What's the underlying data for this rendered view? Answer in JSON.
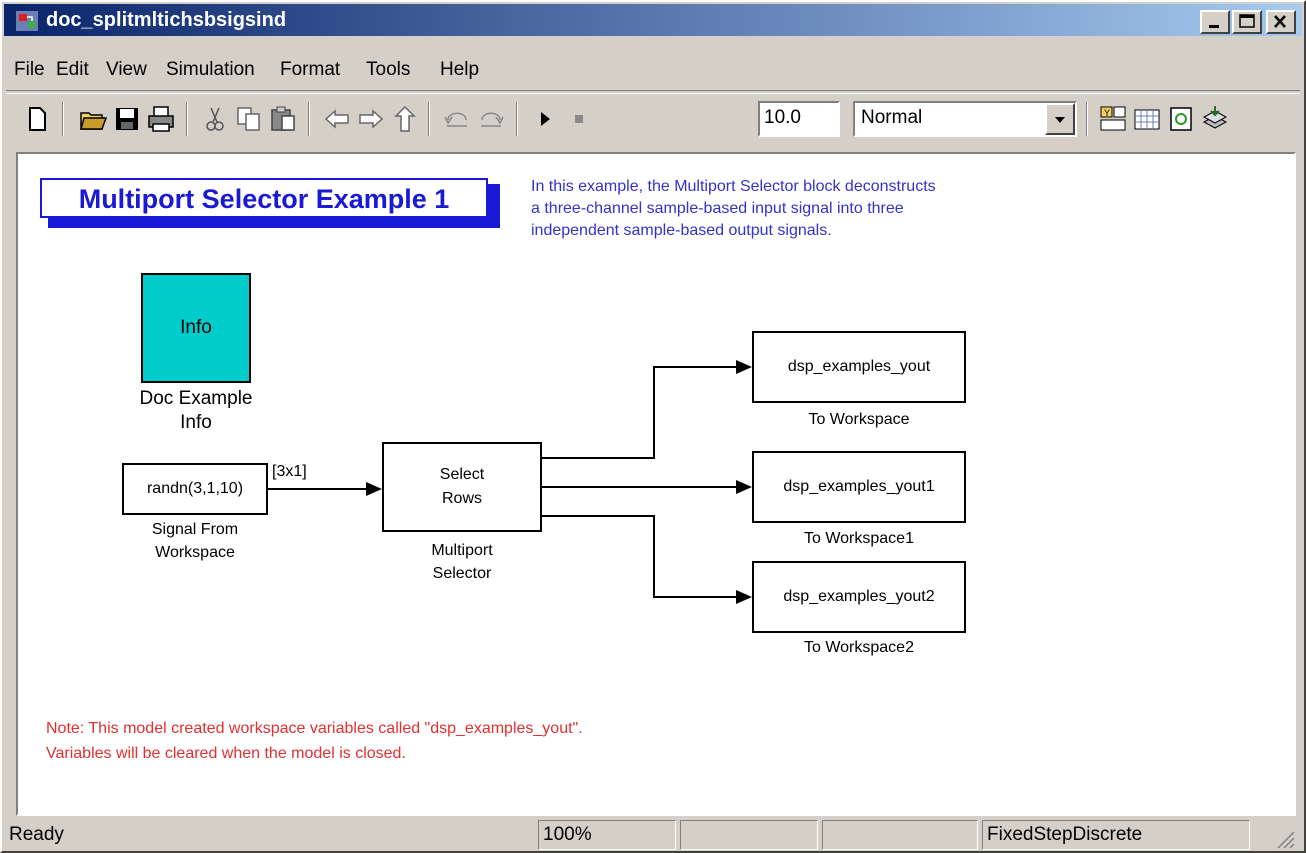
{
  "window": {
    "title": "doc_splitmltichsbsigsind"
  },
  "menu": [
    "File",
    "Edit",
    "View",
    "Simulation",
    "Format",
    "Tools",
    "Help"
  ],
  "toolbar": {
    "stop_time": "10.0",
    "sim_mode": "Normal",
    "icons": [
      "new-model-icon",
      "open-icon",
      "save-icon",
      "print-icon",
      "cut-icon",
      "copy-icon",
      "paste-icon",
      "back-icon",
      "forward-icon",
      "up-icon",
      "undo-icon",
      "redo-icon",
      "start-simulation-icon",
      "stop-simulation-icon",
      "library-browser-icon",
      "model-explorer-icon",
      "update-diagram-icon",
      "build-icon"
    ]
  },
  "diagram": {
    "title": "Multiport Selector Example 1",
    "description": [
      "In this example, the Multiport Selector block deconstructs",
      "a three-channel sample-based input signal into three",
      "independent sample-based output signals."
    ],
    "info_block": {
      "text": "Info",
      "label": [
        "Doc Example",
        "Info"
      ]
    },
    "source_block": {
      "text": "randn(3,1,10)",
      "label": [
        "Signal From",
        "Workspace"
      ]
    },
    "signal_dim": "[3x1]",
    "selector_block": {
      "text": [
        "Select",
        "Rows"
      ],
      "label": [
        "Multiport",
        "Selector"
      ]
    },
    "outputs": [
      {
        "text": "dsp_examples_yout",
        "label": "To Workspace"
      },
      {
        "text": "dsp_examples_yout1",
        "label": "To Workspace1"
      },
      {
        "text": "dsp_examples_yout2",
        "label": "To Workspace2"
      }
    ],
    "note": [
      "Note: This model created workspace variables called \"dsp_examples_yout\".",
      "Variables will be cleared when the model is closed."
    ],
    "colors": {
      "title": "#1a1ad6",
      "description": "#3333cc",
      "note": "#e03030",
      "info_fill": "#00cccc"
    }
  },
  "status": {
    "state": "Ready",
    "zoom": "100%",
    "cell3": "",
    "cell4": "",
    "solver": "FixedStepDiscrete"
  }
}
